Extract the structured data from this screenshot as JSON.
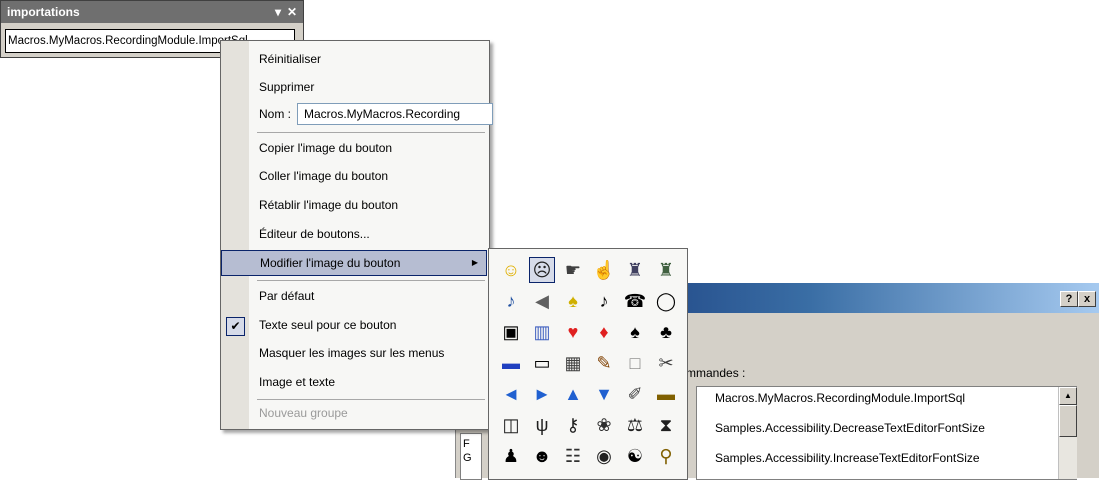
{
  "toolbar": {
    "title": "importations",
    "dropdown_glyph": "▾",
    "close_glyph": "✕",
    "button_text": "Macros.MyMacros.RecordingModule.ImportSql"
  },
  "menu": {
    "reset": "Réinitialiser",
    "delete": "Supprimer",
    "name_label": "Nom :",
    "name_value": "Macros.MyMacros.Recording",
    "copy_image": "Copier l'image du bouton",
    "paste_image": "Coller l'image du bouton",
    "restore_image": "Rétablir l'image du bouton",
    "button_editor": "Éditeur de boutons...",
    "change_image": "Modifier l'image du bouton",
    "default_style": "Par défaut",
    "text_only": "Texte seul pour ce bouton",
    "hide_images": "Masquer les images sur les menus",
    "image_and_text": "Image et texte",
    "new_group": "Nouveau groupe",
    "check_glyph": "✔",
    "submenu_arrow": "▶"
  },
  "palette": {
    "icons": [
      {
        "name": "smiley-icon",
        "glyph": "☺",
        "color": "#e0b000"
      },
      {
        "name": "frowny-icon",
        "glyph": "☹",
        "color": "#202020"
      },
      {
        "name": "pointing-hand-icon",
        "glyph": "☛",
        "color": "#404040"
      },
      {
        "name": "pointing-up-hand-icon",
        "glyph": "☝",
        "color": "#404040"
      },
      {
        "name": "factory-icon",
        "glyph": "♜",
        "color": "#404060"
      },
      {
        "name": "factory-alt-icon",
        "glyph": "♜",
        "color": "#406040"
      },
      {
        "name": "guitar-icon",
        "glyph": "♪",
        "color": "#2050a0"
      },
      {
        "name": "speaker-icon",
        "glyph": "◀",
        "color": "#606060"
      },
      {
        "name": "bell-icon",
        "glyph": "♠",
        "color": "#d0b000"
      },
      {
        "name": "music-note-icon",
        "glyph": "♪",
        "color": "#000000"
      },
      {
        "name": "telephone-icon",
        "glyph": "☎",
        "color": "#000000"
      },
      {
        "name": "speech-bubble-icon",
        "glyph": "◯",
        "color": "#000000"
      },
      {
        "name": "camera-icon",
        "glyph": "▣",
        "color": "#000000"
      },
      {
        "name": "trash-can-icon",
        "glyph": "▥",
        "color": "#4060c0"
      },
      {
        "name": "heart-icon",
        "glyph": "♥",
        "color": "#e02020"
      },
      {
        "name": "diamond-icon",
        "glyph": "♦",
        "color": "#e02020"
      },
      {
        "name": "spade-icon",
        "glyph": "♠",
        "color": "#000000"
      },
      {
        "name": "club-icon",
        "glyph": "♣",
        "color": "#000000"
      },
      {
        "name": "mug-icon",
        "glyph": "▬",
        "color": "#2040c0"
      },
      {
        "name": "video-camera-icon",
        "glyph": "▭",
        "color": "#000000"
      },
      {
        "name": "bin-icon",
        "glyph": "▦",
        "color": "#404040"
      },
      {
        "name": "pencil-icon",
        "glyph": "✎",
        "color": "#804000"
      },
      {
        "name": "blank-square-icon",
        "glyph": "□",
        "color": "#808080"
      },
      {
        "name": "scissors-icon",
        "glyph": "✂",
        "color": "#404040"
      },
      {
        "name": "arrow-left-icon",
        "glyph": "◄",
        "color": "#2060d0"
      },
      {
        "name": "arrow-right-icon",
        "glyph": "►",
        "color": "#2060d0"
      },
      {
        "name": "arrow-up-icon",
        "glyph": "▲",
        "color": "#2060d0"
      },
      {
        "name": "arrow-down-icon",
        "glyph": "▼",
        "color": "#2060d0"
      },
      {
        "name": "pushpin-icon",
        "glyph": "✐",
        "color": "#404040"
      },
      {
        "name": "tape-icon",
        "glyph": "▬",
        "color": "#806000"
      },
      {
        "name": "book-icon",
        "glyph": "◫",
        "color": "#202020"
      },
      {
        "name": "antenna-icon",
        "glyph": "ψ",
        "color": "#202020"
      },
      {
        "name": "key-icon",
        "glyph": "⚷",
        "color": "#202020"
      },
      {
        "name": "brain-icon",
        "glyph": "❀",
        "color": "#303030"
      },
      {
        "name": "scales-icon",
        "glyph": "⚖",
        "color": "#202020"
      },
      {
        "name": "hourglass-icon",
        "glyph": "⧗",
        "color": "#202020"
      },
      {
        "name": "person-icon",
        "glyph": "♟",
        "color": "#000000"
      },
      {
        "name": "head-silhouette-icon",
        "glyph": "☻",
        "color": "#000000"
      },
      {
        "name": "figures-icon",
        "glyph": "☷",
        "color": "#303030"
      },
      {
        "name": "eye-icon",
        "glyph": "◉",
        "color": "#202020"
      },
      {
        "name": "yin-yang-icon",
        "glyph": "☯",
        "color": "#000000"
      },
      {
        "name": "keyhole-icon",
        "glyph": "⚲",
        "color": "#806000"
      }
    ]
  },
  "dialog": {
    "help_glyph": "?",
    "close_glyph": "x",
    "commands_label": "mmandes :",
    "commands": [
      "Macros.MyMacros.RecordingModule.ImportSql",
      "Samples.Accessibility.DecreaseTextEditorFontSize",
      "Samples.Accessibility.IncreaseTextEditorFontSize"
    ],
    "left_pane_letters": [
      "F",
      "G"
    ],
    "scroll_up_glyph": "▲"
  }
}
